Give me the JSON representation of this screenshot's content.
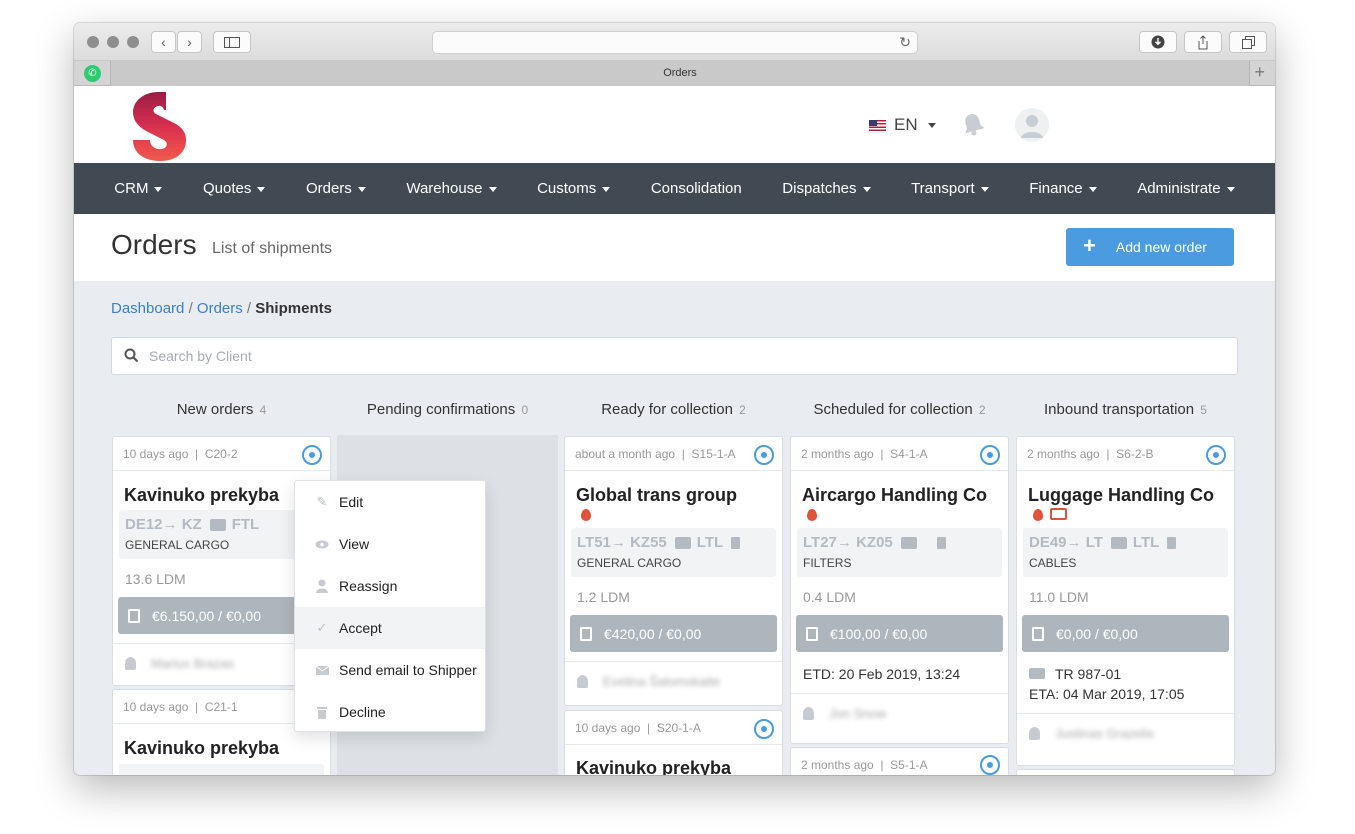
{
  "browser": {
    "tab_title": "Orders"
  },
  "header": {
    "language": "EN"
  },
  "nav": [
    {
      "label": "CRM",
      "dropdown": true
    },
    {
      "label": "Quotes",
      "dropdown": true
    },
    {
      "label": "Orders",
      "dropdown": true
    },
    {
      "label": "Warehouse",
      "dropdown": true
    },
    {
      "label": "Customs",
      "dropdown": true
    },
    {
      "label": "Consolidation",
      "dropdown": false
    },
    {
      "label": "Dispatches",
      "dropdown": true
    },
    {
      "label": "Transport",
      "dropdown": true
    },
    {
      "label": "Finance",
      "dropdown": true
    },
    {
      "label": "Administrate",
      "dropdown": true
    }
  ],
  "page": {
    "title": "Orders",
    "subtitle": "List of shipments",
    "add_button": "Add new order"
  },
  "breadcrumb": {
    "dashboard": "Dashboard",
    "orders": "Orders",
    "sep": "/",
    "current": "Shipments"
  },
  "search": {
    "placeholder": "Search by Client"
  },
  "columns": [
    {
      "title": "New orders",
      "count": "4"
    },
    {
      "title": "Pending confirmations",
      "count": "0"
    },
    {
      "title": "Ready for collection",
      "count": "2"
    },
    {
      "title": "Scheduled for collection",
      "count": "2"
    },
    {
      "title": "Inbound transportation",
      "count": "5"
    }
  ],
  "cards": {
    "new1": {
      "meta": "10 days ago  |  C20-2",
      "client": "Kavinuko prekyba",
      "from": "DE12",
      "to": "KZ",
      "load": "FTL",
      "cargo": "GENERAL CARGO",
      "ldm": "13.6 LDM",
      "price": "€6.150,00 / €0,00",
      "assignee": "Marius Brazas"
    },
    "new2": {
      "meta": "10 days ago  |  C21-1",
      "client": "Kavinuko prekyba"
    },
    "ready1": {
      "meta": "about a month ago  |  S15-1-A",
      "client": "Global trans group",
      "from": "LT51",
      "to": "KZ55",
      "load": "LTL",
      "cargo": "GENERAL CARGO",
      "ldm": "1.2 LDM",
      "price": "€420,00 / €0,00",
      "assignee": "Evelina Šalomskaite"
    },
    "ready2": {
      "meta": "10 days ago  |  S20-1-A",
      "client": "Kavinuko prekyba"
    },
    "sched1": {
      "meta": "2 months ago  |  S4-1-A",
      "client": "Aircargo Handling Co",
      "from": "LT27",
      "to": "KZ05",
      "cargo": "FILTERS",
      "ldm": "0.4 LDM",
      "price": "€100,00 / €0,00",
      "etd": "ETD: 20 Feb 2019, 13:24",
      "assignee": "Jon Snow"
    },
    "sched2": {
      "meta": "2 months ago  |  S5-1-A"
    },
    "inb1": {
      "meta": "2 months ago  |  S6-2-B",
      "client": "Luggage Handling Co",
      "from": "DE49",
      "to": "LT",
      "load": "LTL",
      "cargo": "CABLES",
      "ldm": "11.0 LDM",
      "price": "€0,00 / €0,00",
      "truck": "TR 987-01",
      "eta": "ETA: 04 Mar 2019, 17:05",
      "assignee": "Justinas Grazelis"
    }
  },
  "dropdown_menu": [
    {
      "label": "Edit",
      "icon": "pencil-icon"
    },
    {
      "label": "View",
      "icon": "eye-icon"
    },
    {
      "label": "Reassign",
      "icon": "user-icon"
    },
    {
      "label": "Accept",
      "icon": "check-icon"
    },
    {
      "label": "Send email to Shipper",
      "icon": "envelope-icon"
    },
    {
      "label": "Decline",
      "icon": "trash-icon"
    }
  ],
  "colors": {
    "nav_bg": "#414953",
    "accent": "#4a9be0",
    "price_bar": "#aeb6bd",
    "fire": "#e0533a"
  }
}
